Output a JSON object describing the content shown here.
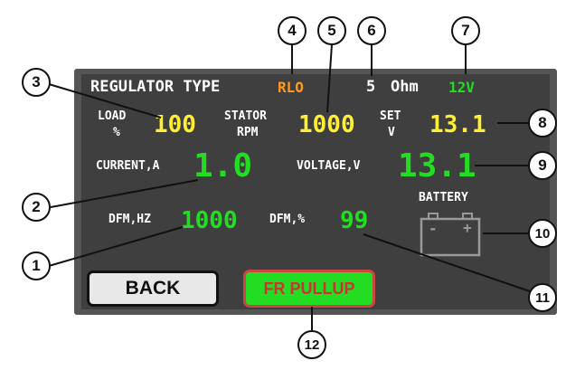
{
  "header": {
    "regulator_label": "REGULATOR TYPE",
    "regulator_value": "RLO",
    "resistance_value": "5",
    "resistance_unit": "Ohm",
    "voltage_rating": "12V"
  },
  "row1": {
    "load_label_1": "LOAD",
    "load_label_2": "%",
    "load_value": "100",
    "stator_label_1": "STATOR",
    "stator_label_2": "RPM",
    "stator_value": "1000",
    "set_label_1": "SET",
    "set_label_2": "V",
    "set_value": "13.1"
  },
  "row2": {
    "current_label": "CURRENT,A",
    "current_value": "1.0",
    "voltage_label": "VOLTAGE,V",
    "voltage_value": "13.1"
  },
  "row3": {
    "dfm_hz_label": "DFM,HZ",
    "dfm_hz_value": "1000",
    "dfm_pct_label": "DFM,%",
    "dfm_pct_value": "99",
    "battery_label": "BATTERY",
    "battery_minus": "-",
    "battery_plus": "+"
  },
  "buttons": {
    "back_label": "BACK",
    "pullup_label": "FR PULLUP"
  },
  "callouts": [
    "1",
    "2",
    "3",
    "4",
    "5",
    "6",
    "7",
    "8",
    "9",
    "10",
    "11",
    "12"
  ],
  "colors": {
    "panel_bg": "#3f3f3f",
    "value_yellow": "#ffee33",
    "value_green": "#22dd22",
    "regulator_orange": "#ff9922",
    "pullup_text": "#cc3333"
  }
}
